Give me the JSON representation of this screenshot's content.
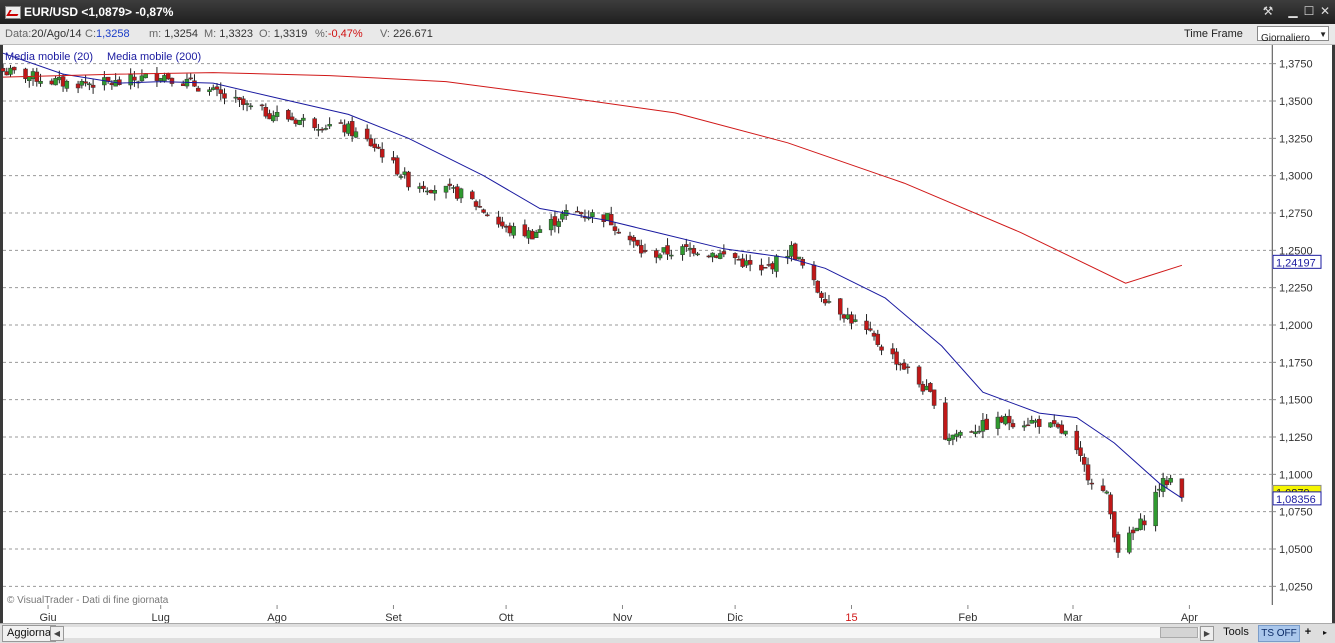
{
  "window": {
    "title": "EUR/USD <1,0879> -0,87%",
    "controls": {
      "tools": "⚒",
      "minimize": "▁",
      "maximize": "☐",
      "close": "✕"
    }
  },
  "infobar": {
    "date_label": "Data:",
    "date_value": "20/Ago/14",
    "close_label": "C:",
    "close_value": "1,3258",
    "min_label": "m:",
    "min_value": "1,3254",
    "max_label": "M:",
    "max_value": "1,3323",
    "open_label": "O:",
    "open_value": "1,3319",
    "pct_label": "%:",
    "pct_value": "-0,47%",
    "vol_label": "V:",
    "vol_value": "226.671",
    "timeframe_label": "Time Frame",
    "timeframe_value": "Giornaliero"
  },
  "bottombar": {
    "refresh": "Aggiorna",
    "tools": "Tools",
    "ts": "TS OFF",
    "plus": "+",
    "more": "▸"
  },
  "colors": {
    "background": "#ffffff",
    "grid": "#9a9a9a",
    "bull": "#2f9a2f",
    "bear": "#c01818",
    "ma20": "#1a1aa0",
    "ma200": "#d01818",
    "last_price_bg": "#f5f500"
  },
  "chart_data": {
    "type": "candlestick",
    "legend": [
      "Media mobile (20)",
      "Media mobile (200)"
    ],
    "watermark": "© VisualTrader - Dati di fine giornata",
    "ylim": [
      1.0125,
      1.3875
    ],
    "y_ticks": [
      "1,3750",
      "1,3500",
      "1,3250",
      "1,3000",
      "1,2750",
      "1,2500",
      "1,2250",
      "1,2000",
      "1,1750",
      "1,1500",
      "1,1250",
      "1,1000",
      "1,0750",
      "1,0500",
      "1,0250"
    ],
    "y_tick_values": [
      1.375,
      1.35,
      1.325,
      1.3,
      1.275,
      1.25,
      1.225,
      1.2,
      1.175,
      1.15,
      1.125,
      1.1,
      1.075,
      1.05,
      1.025
    ],
    "x_ticks": [
      {
        "label": "Giu",
        "date": "2014-06-01"
      },
      {
        "label": "Lug",
        "date": "2014-07-01"
      },
      {
        "label": "Ago",
        "date": "2014-08-01"
      },
      {
        "label": "Set",
        "date": "2014-09-01"
      },
      {
        "label": "Ott",
        "date": "2014-10-01"
      },
      {
        "label": "Nov",
        "date": "2014-11-01"
      },
      {
        "label": "Dic",
        "date": "2014-12-01"
      },
      {
        "label": "15",
        "date": "2015-01-01",
        "highlight": true
      },
      {
        "label": "Feb",
        "date": "2015-02-01"
      },
      {
        "label": "Mar",
        "date": "2015-03-01"
      },
      {
        "label": "Apr",
        "date": "2015-04-01"
      }
    ],
    "x_range": [
      "2014-05-20",
      "2015-04-23"
    ],
    "close_path": [
      [
        "2014-05-20",
        1.37
      ],
      [
        "2014-06-05",
        1.362
      ],
      [
        "2014-06-20",
        1.362
      ],
      [
        "2014-07-01",
        1.368
      ],
      [
        "2014-07-10",
        1.361
      ],
      [
        "2014-07-25",
        1.345
      ],
      [
        "2014-08-05",
        1.338
      ],
      [
        "2014-08-20",
        1.331
      ],
      [
        "2014-08-28",
        1.318
      ],
      [
        "2014-09-05",
        1.296
      ],
      [
        "2014-09-20",
        1.287
      ],
      [
        "2014-10-01",
        1.264
      ],
      [
        "2014-10-08",
        1.261
      ],
      [
        "2014-10-18",
        1.276
      ],
      [
        "2014-10-28",
        1.272
      ],
      [
        "2014-11-07",
        1.247
      ],
      [
        "2014-11-20",
        1.251
      ],
      [
        "2014-12-01",
        1.245
      ],
      [
        "2014-12-08",
        1.235
      ],
      [
        "2014-12-16",
        1.251
      ],
      [
        "2014-12-23",
        1.223
      ],
      [
        "2015-01-05",
        1.195
      ],
      [
        "2015-01-15",
        1.172
      ],
      [
        "2015-01-23",
        1.15
      ],
      [
        "2015-01-26",
        1.125
      ],
      [
        "2015-02-02",
        1.13
      ],
      [
        "2015-02-10",
        1.136
      ],
      [
        "2015-02-20",
        1.135
      ],
      [
        "2015-02-27",
        1.127
      ],
      [
        "2015-03-05",
        1.1
      ],
      [
        "2015-03-10",
        1.085
      ],
      [
        "2015-03-13",
        1.05
      ],
      [
        "2015-03-17",
        1.06
      ],
      [
        "2015-03-20",
        1.07
      ],
      [
        "2015-03-24",
        1.092
      ],
      [
        "2015-03-27",
        1.097
      ],
      [
        "2015-03-30",
        1.0879
      ]
    ],
    "ma20": [
      [
        "2014-05-20",
        1.382
      ],
      [
        "2014-06-05",
        1.368
      ],
      [
        "2014-06-20",
        1.362
      ],
      [
        "2014-07-01",
        1.363
      ],
      [
        "2014-07-15",
        1.362
      ],
      [
        "2014-08-01",
        1.352
      ],
      [
        "2014-08-20",
        1.341
      ],
      [
        "2014-09-05",
        1.325
      ],
      [
        "2014-09-25",
        1.3
      ],
      [
        "2014-10-10",
        1.278
      ],
      [
        "2014-10-28",
        1.27
      ],
      [
        "2014-11-10",
        1.262
      ],
      [
        "2014-11-28",
        1.251
      ],
      [
        "2014-12-15",
        1.245
      ],
      [
        "2014-12-25",
        1.238
      ],
      [
        "2015-01-10",
        1.218
      ],
      [
        "2015-01-25",
        1.186
      ],
      [
        "2015-02-05",
        1.155
      ],
      [
        "2015-02-20",
        1.141
      ],
      [
        "2015-03-02",
        1.138
      ],
      [
        "2015-03-12",
        1.121
      ],
      [
        "2015-03-24",
        1.094
      ],
      [
        "2015-03-30",
        1.084
      ]
    ],
    "ma200": [
      [
        "2014-05-20",
        1.366
      ],
      [
        "2014-06-20",
        1.368
      ],
      [
        "2014-07-15",
        1.369
      ],
      [
        "2014-08-15",
        1.367
      ],
      [
        "2014-09-15",
        1.363
      ],
      [
        "2014-10-15",
        1.353
      ],
      [
        "2014-11-15",
        1.342
      ],
      [
        "2014-12-15",
        1.322
      ],
      [
        "2015-01-15",
        1.295
      ],
      [
        "2015-02-15",
        1.262
      ],
      [
        "2015-03-15",
        1.228
      ],
      [
        "2015-03-30",
        1.2419
      ]
    ],
    "ma200_end": 1.24,
    "price_labels": [
      {
        "label": "1,24197",
        "value": 1.24197,
        "style": "ma200"
      },
      {
        "label": "1,0879",
        "value": 1.0879,
        "style": "last"
      },
      {
        "label": "1,08356",
        "value": 1.08356,
        "style": "ma20"
      }
    ]
  }
}
